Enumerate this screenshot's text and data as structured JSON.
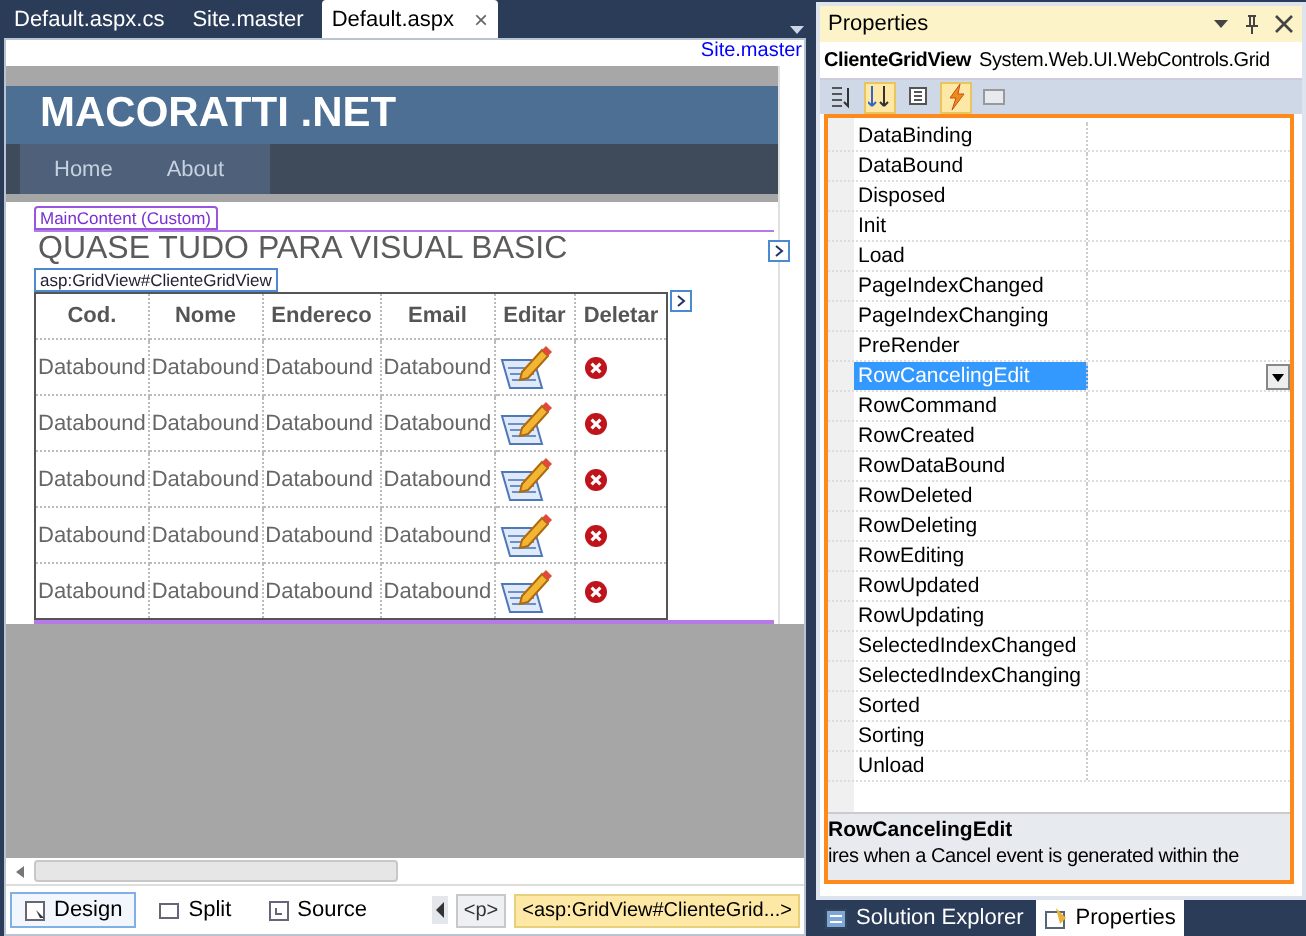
{
  "editor_tabs": [
    {
      "label": "Default.aspx.cs",
      "selected": false
    },
    {
      "label": "Site.master",
      "selected": false
    },
    {
      "label": "Default.aspx",
      "selected": true,
      "close": "×"
    }
  ],
  "master_link": "Site.master",
  "site": {
    "title": "MACORATTI .NET",
    "menu": [
      "Home",
      "About"
    ]
  },
  "content_tag": "MainContent (Custom)",
  "heading": "QUASE TUDO PARA VISUAL BASIC",
  "grid_tag": "asp:GridView#ClienteGridView",
  "grid": {
    "columns": [
      "Cod.",
      "Nome",
      "Endereco",
      "Email",
      "Editar",
      "Deletar"
    ],
    "rows": [
      [
        "Databound",
        "Databound",
        "Databound",
        "Databound"
      ],
      [
        "Databound",
        "Databound",
        "Databound",
        "Databound"
      ],
      [
        "Databound",
        "Databound",
        "Databound",
        "Databound"
      ],
      [
        "Databound",
        "Databound",
        "Databound",
        "Databound"
      ],
      [
        "Databound",
        "Databound",
        "Databound",
        "Databound"
      ]
    ]
  },
  "views": [
    {
      "label": "Design",
      "selected": true
    },
    {
      "label": "Split",
      "selected": false
    },
    {
      "label": "Source",
      "selected": false
    }
  ],
  "breadcrumb": [
    "<p>",
    "<asp:GridView#ClienteGrid...>"
  ],
  "properties": {
    "title": "Properties",
    "object_name": "ClienteGridView",
    "object_type": "System.Web.UI.WebControls.Grid",
    "events": [
      {
        "name": "DataBinding",
        "selected": false
      },
      {
        "name": "DataBound",
        "selected": false
      },
      {
        "name": "Disposed",
        "selected": false
      },
      {
        "name": "Init",
        "selected": false
      },
      {
        "name": "Load",
        "selected": false
      },
      {
        "name": "PageIndexChanged",
        "selected": false
      },
      {
        "name": "PageIndexChanging",
        "selected": false
      },
      {
        "name": "PreRender",
        "selected": false
      },
      {
        "name": "RowCancelingEdit",
        "selected": true
      },
      {
        "name": "RowCommand",
        "selected": false
      },
      {
        "name": "RowCreated",
        "selected": false
      },
      {
        "name": "RowDataBound",
        "selected": false
      },
      {
        "name": "RowDeleted",
        "selected": false
      },
      {
        "name": "RowDeleting",
        "selected": false
      },
      {
        "name": "RowEditing",
        "selected": false
      },
      {
        "name": "RowUpdated",
        "selected": false
      },
      {
        "name": "RowUpdating",
        "selected": false
      },
      {
        "name": "SelectedIndexChanged",
        "selected": false
      },
      {
        "name": "SelectedIndexChanging",
        "selected": false
      },
      {
        "name": "Sorted",
        "selected": false
      },
      {
        "name": "Sorting",
        "selected": false
      },
      {
        "name": "Unload",
        "selected": false
      }
    ],
    "description_title": "RowCancelingEdit",
    "description": "ires when a Cancel event is generated within the"
  },
  "bottom_tabs": [
    {
      "label": "Solution Explorer",
      "selected": false
    },
    {
      "label": "Properties",
      "selected": true
    }
  ]
}
